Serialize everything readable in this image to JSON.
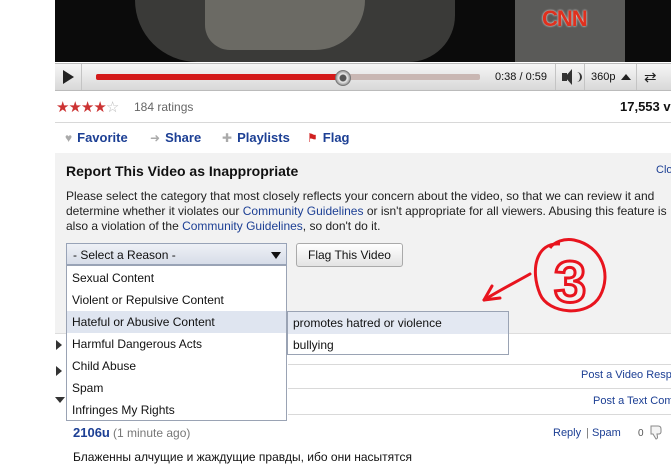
{
  "player": {
    "watermark": "CNN",
    "progress_fraction": 0.64,
    "time": "0:38 / 0:59",
    "quality": "360p"
  },
  "rating": {
    "stars": 3.5,
    "count_label": "184 ratings",
    "views": "17,553 vi"
  },
  "actions": {
    "favorite": "Favorite",
    "share": "Share",
    "playlists": "Playlists",
    "flag": "Flag"
  },
  "report": {
    "title": "Report This Video as Inappropriate",
    "close": "Clo",
    "desc_1": "Please select the category that most closely reflects your concern about the video, so that we can review it and determine whether it violates our ",
    "desc_link_1": "Community Guidelines",
    "desc_2": " or isn't appropriate for all viewers. Abusing this feature is also a violation of the ",
    "desc_link_2": "Community Guidelines",
    "desc_3": ", so don't do it.",
    "select_label": "- Select a Reason -",
    "flag_button": "Flag This Video",
    "reasons": [
      "Sexual Content",
      "Violent or Repulsive Content",
      "Hateful or Abusive Content",
      "Harmful Dangerous Acts",
      "Child Abuse",
      "Spam",
      "Infringes My Rights"
    ],
    "highlighted_reason": "Hateful or Abusive Content",
    "subreasons": [
      "promotes hatred or violence",
      "bullying"
    ]
  },
  "annotation": {
    "number": "3",
    "color": "#e8141e"
  },
  "comments": {
    "post_video": "Post a Video Resp",
    "post_text": "Post a Text Com",
    "user": "2106u",
    "time": "(1 minute ago)",
    "reply": "Reply",
    "sep": "|",
    "spam": "Spam",
    "score": "0",
    "text": "Блаженны алчущие и жаждущие правды, ибо они насытятся"
  }
}
